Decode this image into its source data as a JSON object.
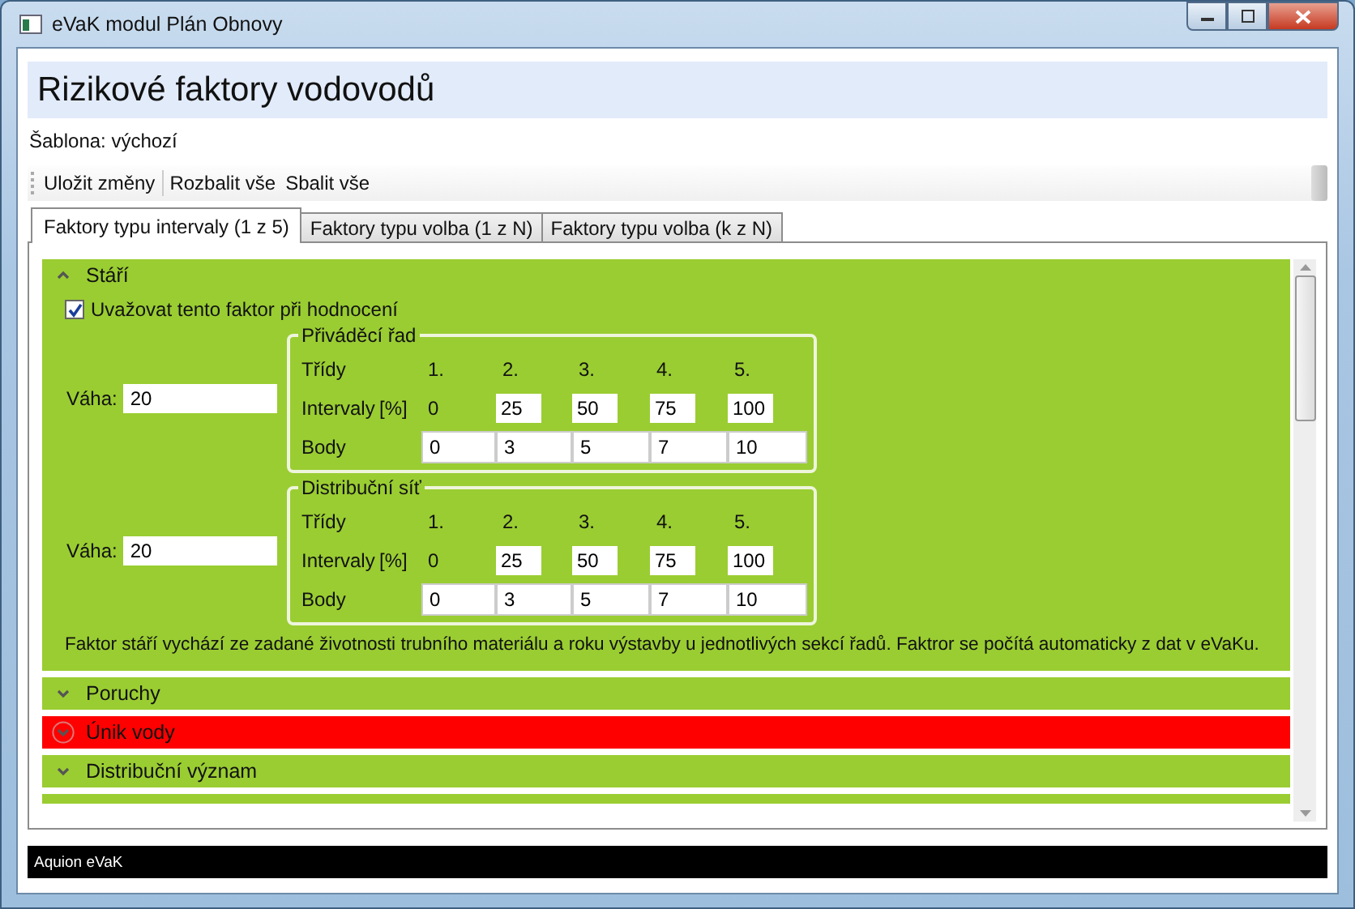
{
  "window": {
    "title": "eVaK modul Plán Obnovy"
  },
  "header": {
    "title": "Rizikové faktory vodovodů",
    "template": "Šablona: výchozí"
  },
  "toolbar": [
    "Uložit změny",
    "Rozbalit vše",
    "Sbalit vše"
  ],
  "tabs": [
    {
      "label": "Faktory typu intervaly (1 z 5)",
      "selected": true
    },
    {
      "label": "Faktory typu volba (1 z N)",
      "selected": false
    },
    {
      "label": "Faktory typu volba (k z N)",
      "selected": false
    }
  ],
  "sections": [
    {
      "title": "Stáří",
      "expanded": true,
      "color": "#9acd32",
      "consider": {
        "label": "Uvažovat tento faktor při hodnocení",
        "checked": true
      },
      "groups": [
        {
          "title": "Přiváděcí řad",
          "weight_label": "Váha:",
          "weight": "20",
          "classes_label": "Třídy",
          "classes": [
            "1.",
            "2.",
            "3.",
            "4.",
            "5."
          ],
          "intervals_label": "Intervaly",
          "unit": "[%]",
          "interval_first": "0",
          "intervals": [
            "25",
            "50",
            "75",
            "100"
          ],
          "points_label": "Body",
          "points": [
            "0",
            "3",
            "5",
            "7",
            "10"
          ]
        },
        {
          "title": "Distribuční síť",
          "weight_label": "Váha:",
          "weight": "20",
          "classes_label": "Třídy",
          "classes": [
            "1.",
            "2.",
            "3.",
            "4.",
            "5."
          ],
          "intervals_label": "Intervaly",
          "unit": "[%]",
          "interval_first": "0",
          "intervals": [
            "25",
            "50",
            "75",
            "100"
          ],
          "points_label": "Body",
          "points": [
            "0",
            "3",
            "5",
            "7",
            "10"
          ]
        }
      ],
      "description": "Faktor stáří vychází ze zadané životnosti trubního materiálu a roku výstavby u jednotlivých sekcí řadů. Faktror se počítá automaticky z dat v eVaKu."
    },
    {
      "title": "Poruchy",
      "expanded": false,
      "color": "#9acd32"
    },
    {
      "title": "Únik vody",
      "expanded": false,
      "color": "#ff0000"
    },
    {
      "title": "Distribuční význam",
      "expanded": false,
      "color": "#9acd32"
    }
  ],
  "status_bar": "Aquion eVaK"
}
